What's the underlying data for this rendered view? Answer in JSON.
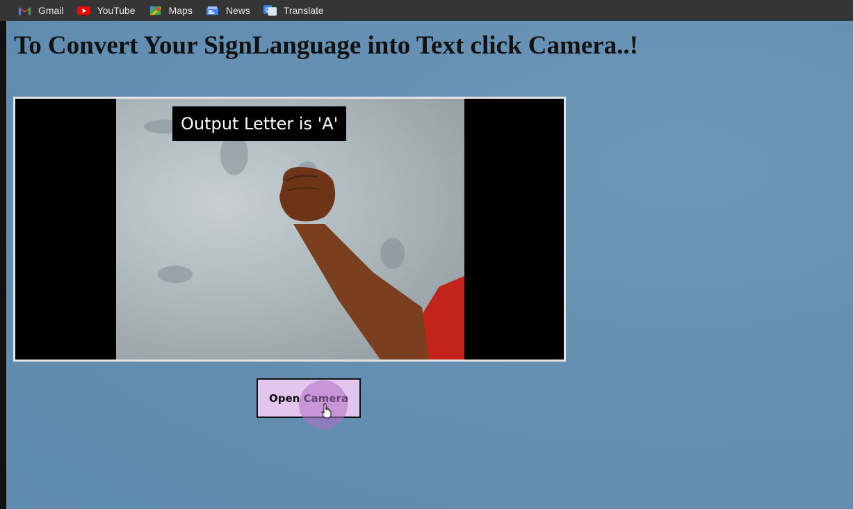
{
  "bookmarks": [
    {
      "label": "Gmail",
      "icon": "gmail-icon"
    },
    {
      "label": "YouTube",
      "icon": "youtube-icon"
    },
    {
      "label": "Maps",
      "icon": "maps-icon"
    },
    {
      "label": "News",
      "icon": "news-icon"
    },
    {
      "label": "Translate",
      "icon": "translate-icon"
    }
  ],
  "page": {
    "title": "To Convert Your SignLanguage into Text click Camera..!",
    "output_label": "Output Letter is 'A'",
    "open_camera_label": "Open Camera"
  },
  "colors": {
    "background": "#5f8db0",
    "button": "#e3c6ee",
    "bookmarks_bar": "#353535"
  }
}
